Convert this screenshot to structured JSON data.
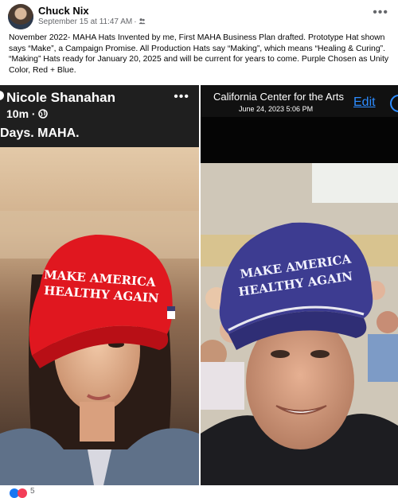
{
  "post": {
    "author": "Chuck Nix",
    "timestamp": "September 15 at 11:47 AM",
    "separator": "·",
    "text": "November 2022- MAHA Hats Invented by me, First MAHA Business Plan drafted. Prototype Hat shown says “Make”, a Campaign Promise. All Production Hats say “Making”, which means “Healing & Curing”. “Making” Hats ready for January 20, 2025 and will be current for years to come. Purple Chosen as Unity Color, Red + Blue.",
    "more_icon": "more-horizontal-icon",
    "audience_icon": "friends-icon"
  },
  "left_image": {
    "name": "Nicole Shanahan",
    "time": "10m ·",
    "caption": "Days. MAHA.",
    "hat_line1": "MAKE AMERICA",
    "hat_line2": "HEALTHY AGAIN",
    "hat_color": "#e31b23"
  },
  "right_image": {
    "title": "California Center for the Arts",
    "date": "June 24, 2023  5:06 PM",
    "edit_label": "Edit",
    "hat_line1": "MAKE AMERICA",
    "hat_line2": "HEALTHY AGAIN",
    "hat_color": "#3b3a8f"
  },
  "reactions": {
    "icons": [
      "like-icon",
      "love-icon"
    ],
    "count": "5"
  }
}
